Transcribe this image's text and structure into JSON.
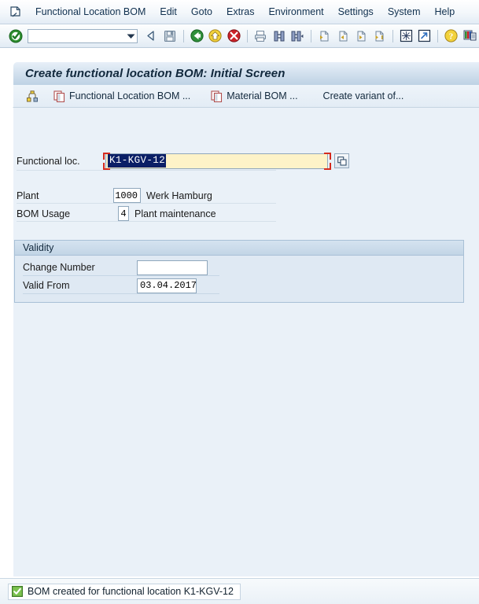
{
  "menubar": {
    "system_icon": "system-menu-icon",
    "items": [
      {
        "label": "Functional Location BOM",
        "accel_index": 5
      },
      {
        "label": "Edit",
        "accel_index": 0
      },
      {
        "label": "Goto",
        "accel_index": 0
      },
      {
        "label": "Extras",
        "accel_index": 4
      },
      {
        "label": "Environment",
        "accel_index": 2
      },
      {
        "label": "Settings",
        "accel_index": 0
      },
      {
        "label": "System",
        "accel_index": 1
      },
      {
        "label": "Help",
        "accel_index": 0
      }
    ]
  },
  "toolbar": {
    "enter_icon": "green-check-enter-icon",
    "command_field_value": "",
    "command_field_placeholder": "",
    "dropdown_icon": "chevron-down-icon",
    "icons": [
      "back-arrow-icon",
      "save-icon",
      "back-green-icon",
      "exit-yellow-icon",
      "cancel-red-icon",
      "print-icon",
      "find-icon",
      "find-next-icon",
      "first-page-icon",
      "previous-page-icon",
      "next-page-icon",
      "last-page-icon",
      "create-session-icon",
      "create-shortcut-icon",
      "help-icon",
      "customize-local-layout-icon"
    ]
  },
  "title": "Create functional location BOM: Initial Screen",
  "apptoolbar": {
    "buttons": [
      {
        "label": "",
        "icon": "structure-icon"
      },
      {
        "label": "Functional Location BOM ...",
        "icon": "copy-document-icon"
      },
      {
        "label": "Material BOM ...",
        "icon": "copy-document-icon"
      },
      {
        "label": "Create variant of...",
        "icon": ""
      }
    ]
  },
  "form": {
    "functional_loc": {
      "label": "Functional loc.",
      "value": "K1-KGV-12",
      "selected": true,
      "help_icon": "search-help-icon"
    },
    "plant": {
      "label": "Plant",
      "value": "1000",
      "description": "Werk Hamburg"
    },
    "bom_usage": {
      "label": "BOM Usage",
      "value": "4",
      "description": "Plant maintenance"
    }
  },
  "validity": {
    "title": "Validity",
    "change_number": {
      "label": "Change Number",
      "value": ""
    },
    "valid_from": {
      "label": "Valid From",
      "value": "03.04.2017"
    }
  },
  "statusbar": {
    "icon": "success-check-icon",
    "message": "BOM created for functional location K1-KGV-12"
  },
  "colors": {
    "title_bar": "#bed2e4",
    "required_field": "#fdf3c8",
    "selection": "#0a1f66",
    "focus_corner": "#d52b1e",
    "success": "#4f9a35",
    "canvas": "#eaf1f8"
  }
}
